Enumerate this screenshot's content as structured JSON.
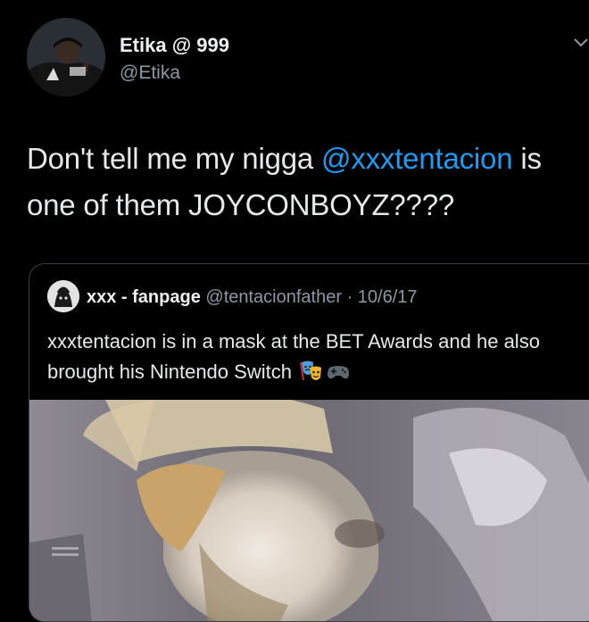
{
  "tweet": {
    "author_name": "Etika @ 999",
    "author_handle": "@Etika",
    "text_before": "Don't tell me my nigga ",
    "mention": "@xxxtentacion",
    "text_after": " is one of them JOYCONBOYZ????"
  },
  "quoted_tweet": {
    "author_name": "xxx - fanpage",
    "author_handle": "@tentacionfather",
    "date": "10/6/17",
    "text": "xxxtentacion is in a mask at the BET Awards and he also brought his Nintendo Switch",
    "emojis": [
      "performing-arts-icon",
      "game-controller-icon"
    ]
  },
  "colors": {
    "background": "#000000",
    "link": "#1d9bf0",
    "secondary_text": "#8b98a5",
    "border": "#3a3f45"
  }
}
